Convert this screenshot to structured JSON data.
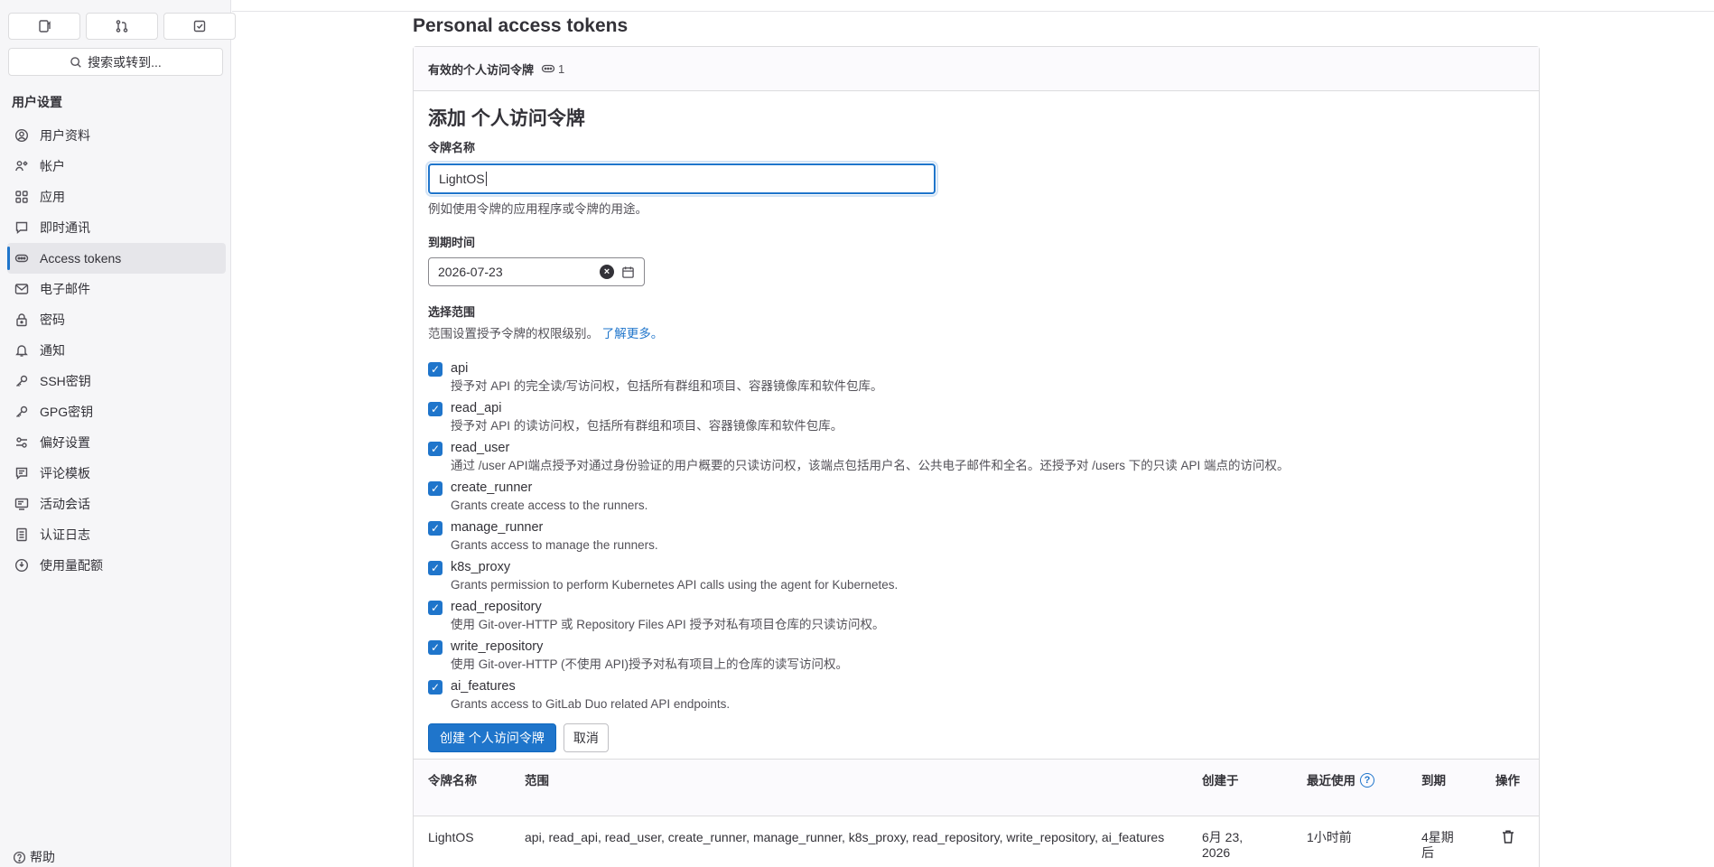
{
  "sidebar": {
    "top_buttons": [
      "issues-icon",
      "merge-request-icon",
      "todo-icon"
    ],
    "search_label": "搜索或转到...",
    "section_title": "用户设置",
    "items": [
      {
        "label": "用户资料",
        "icon": "user-icon"
      },
      {
        "label": "帐户",
        "icon": "account-icon"
      },
      {
        "label": "应用",
        "icon": "applications-icon"
      },
      {
        "label": "即时通讯",
        "icon": "chat-icon"
      },
      {
        "label": "Access tokens",
        "icon": "token-icon",
        "active": true
      },
      {
        "label": "电子邮件",
        "icon": "mail-icon"
      },
      {
        "label": "密码",
        "icon": "lock-icon"
      },
      {
        "label": "通知",
        "icon": "bell-icon"
      },
      {
        "label": "SSH密钥",
        "icon": "key-icon"
      },
      {
        "label": "GPG密钥",
        "icon": "key-icon"
      },
      {
        "label": "偏好设置",
        "icon": "preferences-icon"
      },
      {
        "label": "评论模板",
        "icon": "comment-icon"
      },
      {
        "label": "活动会话",
        "icon": "monitor-icon"
      },
      {
        "label": "认证日志",
        "icon": "log-icon"
      },
      {
        "label": "使用量配额",
        "icon": "quota-icon"
      }
    ],
    "help_label": "帮助"
  },
  "main": {
    "page_title": "Personal access tokens",
    "card_header": {
      "title": "有效的个人访问令牌",
      "count": "1"
    },
    "form": {
      "title": "添加 个人访问令牌",
      "name_label": "令牌名称",
      "name_value": "LightOS",
      "name_help": "例如使用令牌的应用程序或令牌的用途。",
      "expiry_label": "到期时间",
      "expiry_value": "2026-07-23",
      "scope_label": "选择范围",
      "scope_help": "范围设置授予令牌的权限级别。",
      "scope_help_link": "了解更多。",
      "scopes": [
        {
          "name": "api",
          "desc": "授予对 API 的完全读/写访问权，包括所有群组和项目、容器镜像库和软件包库。"
        },
        {
          "name": "read_api",
          "desc": "授予对 API 的读访问权，包括所有群组和项目、容器镜像库和软件包库。"
        },
        {
          "name": "read_user",
          "desc": "通过 /user API端点授予对通过身份验证的用户概要的只读访问权，该端点包括用户名、公共电子邮件和全名。还授予对 /users 下的只读 API 端点的访问权。"
        },
        {
          "name": "create_runner",
          "desc": "Grants create access to the runners."
        },
        {
          "name": "manage_runner",
          "desc": "Grants access to manage the runners."
        },
        {
          "name": "k8s_proxy",
          "desc": "Grants permission to perform Kubernetes API calls using the agent for Kubernetes."
        },
        {
          "name": "read_repository",
          "desc": "使用 Git-over-HTTP 或 Repository Files API 授予对私有项目仓库的只读访问权。"
        },
        {
          "name": "write_repository",
          "desc": "使用 Git-over-HTTP (不使用 API)授予对私有项目上的仓库的读写访问权。"
        },
        {
          "name": "ai_features",
          "desc": "Grants access to GitLab Duo related API endpoints."
        }
      ],
      "create_button": "创建 个人访问令牌",
      "cancel_button": "取消"
    },
    "table": {
      "headers": {
        "name": "令牌名称",
        "scopes": "范围",
        "created": "创建于",
        "last_used": "最近使用",
        "expires": "到期",
        "actions": "操作"
      },
      "rows": [
        {
          "name": "LightOS",
          "scopes": "api, read_api, read_user, create_runner, manage_runner, k8s_proxy, read_repository, write_repository, ai_features",
          "created": "6月 23, 2026",
          "last_used": "1小时前",
          "expires": "4星期后"
        }
      ]
    }
  },
  "colors": {
    "accent": "#1f75cb",
    "sidebar_bg": "#f6f6f8",
    "text": "#333238"
  }
}
